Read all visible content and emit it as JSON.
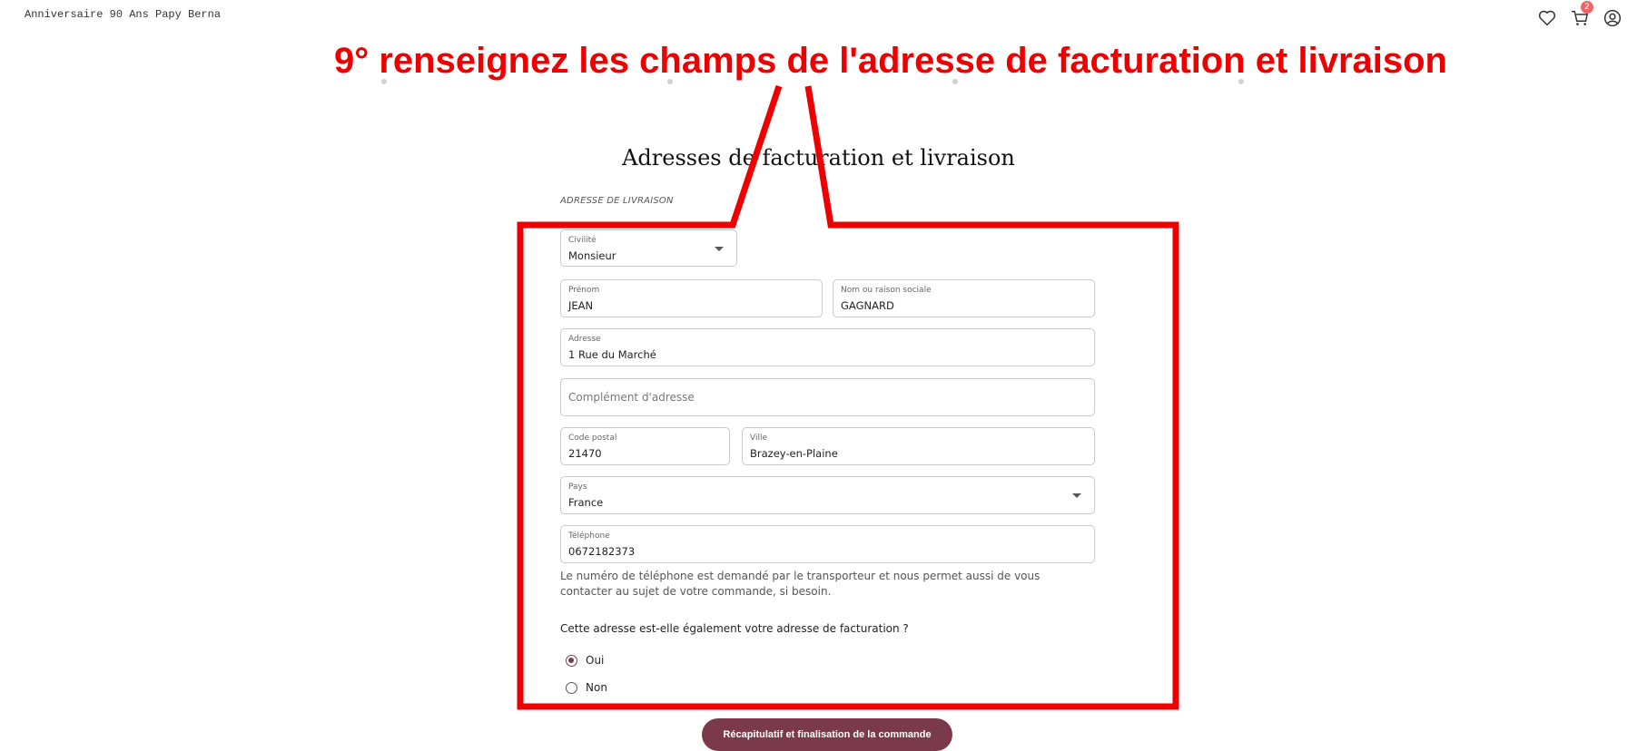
{
  "header": {
    "title": "Anniversaire 90 Ans Papy Berna",
    "icons": [
      "heart-icon",
      "cart-icon",
      "account-icon"
    ],
    "cart_count": "2"
  },
  "annotation": {
    "text": "9° renseignez les champs de l'adresse de facturation et livraison",
    "color": "#ee0000"
  },
  "page": {
    "title": "Adresses de facturation et livraison",
    "section_label": "ADRESSE DE LIVRAISON"
  },
  "form": {
    "civilite": {
      "label": "Civilité",
      "value": "Monsieur"
    },
    "prenom": {
      "label": "Prénom",
      "value": "JEAN"
    },
    "nom": {
      "label": "Nom ou raison sociale",
      "value": "GAGNARD"
    },
    "adresse": {
      "label": "Adresse",
      "value": "1 Rue du Marché"
    },
    "complement": {
      "placeholder": "Complément d'adresse"
    },
    "code_postal": {
      "label": "Code postal",
      "value": "21470"
    },
    "ville": {
      "label": "Ville",
      "value": "Brazey-en-Plaine"
    },
    "pays": {
      "label": "Pays",
      "value": "France"
    },
    "telephone": {
      "label": "Téléphone",
      "value": "0672182373"
    },
    "phone_help": "Le numéro de téléphone est demandé par le transporteur et nous permet aussi de vous contacter au sujet de votre commande, si besoin.",
    "billing_question": "Cette adresse est-elle également votre adresse de facturation ?",
    "billing_options": [
      {
        "label": "Oui",
        "selected": true
      },
      {
        "label": "Non",
        "selected": false
      }
    ]
  },
  "submit_label": "Récapitulatif et finalisation de la commande",
  "colors": {
    "accent": "#7a3a4b",
    "annotation": "#ee0000"
  }
}
